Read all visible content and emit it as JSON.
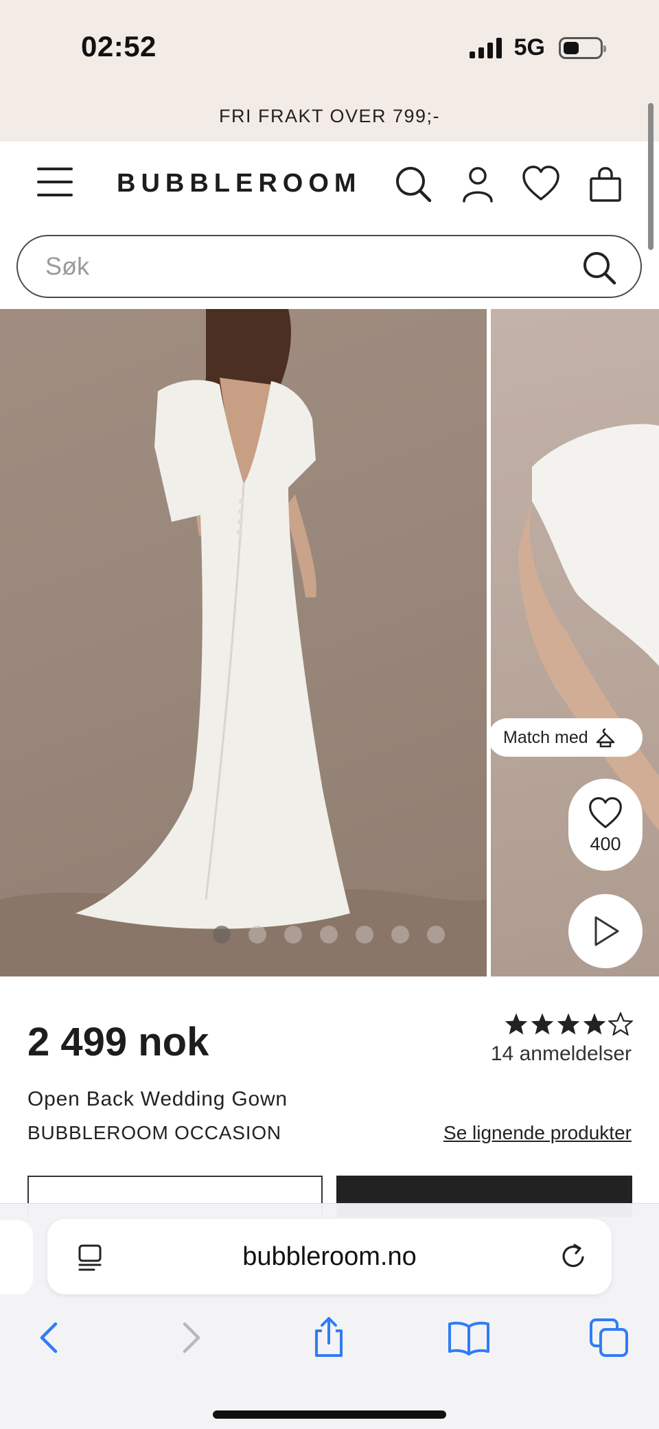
{
  "status_bar": {
    "time": "02:52",
    "network": "5G"
  },
  "promo": {
    "text": "FRI FRAKT OVER 799;-"
  },
  "header": {
    "logo": "BUBBLEROOM",
    "icons": [
      "menu-icon",
      "search-icon",
      "account-icon",
      "heart-icon",
      "bag-icon"
    ]
  },
  "search": {
    "placeholder": "Søk"
  },
  "gallery": {
    "image_count": 7,
    "active_index": 0,
    "match_label": "Match med",
    "like_count": "400"
  },
  "product": {
    "price": "2 499 nok",
    "rating": 4,
    "rating_max": 5,
    "reviews_label": "14 anmeldelser",
    "name": "Open Back Wedding Gown",
    "brand": "BUBBLEROOM OCCASION",
    "similar_link": "Se lignende produkter"
  },
  "browser": {
    "url": "bubbleroom.no",
    "toolbar": [
      "back-icon",
      "forward-icon",
      "share-icon",
      "bookmarks-icon",
      "tabs-icon"
    ]
  },
  "colors": {
    "top_band": "#f3ebe6",
    "ios_blue": "#2f7cf6",
    "dark_button": "#222222"
  }
}
